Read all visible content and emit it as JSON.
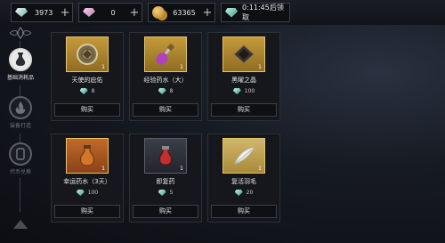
{
  "currency": {
    "gem": "3973",
    "pink_gem": "0",
    "gold": "63365",
    "timer": "0:11:45后领取"
  },
  "sidebar": {
    "tabs": [
      {
        "label": "基础消耗品",
        "active": true,
        "icon": "potion-icon"
      },
      {
        "label": "装备打造",
        "active": false,
        "icon": "flame-icon"
      },
      {
        "label": "代币兑换",
        "active": false,
        "icon": "token-icon"
      }
    ]
  },
  "items": [
    {
      "name": "天使的庇佑",
      "qty": "1",
      "price": "8",
      "buy": "购买",
      "icon": "angel-medal-icon"
    },
    {
      "name": "经验药水（大）",
      "qty": "1",
      "price": "8",
      "buy": "购买",
      "icon": "exp-potion-icon"
    },
    {
      "name": "黑曜之晶",
      "qty": "1",
      "price": "100",
      "buy": "购买",
      "icon": "obsidian-crystal-icon"
    },
    {
      "name": "幸运药水（3天）",
      "qty": "1",
      "price": "100",
      "buy": "购买",
      "icon": "luck-potion-icon"
    },
    {
      "name": "即复药",
      "qty": "1",
      "price": "5",
      "buy": "购买",
      "icon": "revive-potion-icon"
    },
    {
      "name": "复活羽毛",
      "qty": "1",
      "price": "20",
      "buy": "购买",
      "icon": "feather-icon"
    }
  ],
  "colors": {
    "card_frame": "#e4c46a",
    "thumb_bg": "#c49a3a",
    "currency_gem": "#6fb3ad"
  }
}
